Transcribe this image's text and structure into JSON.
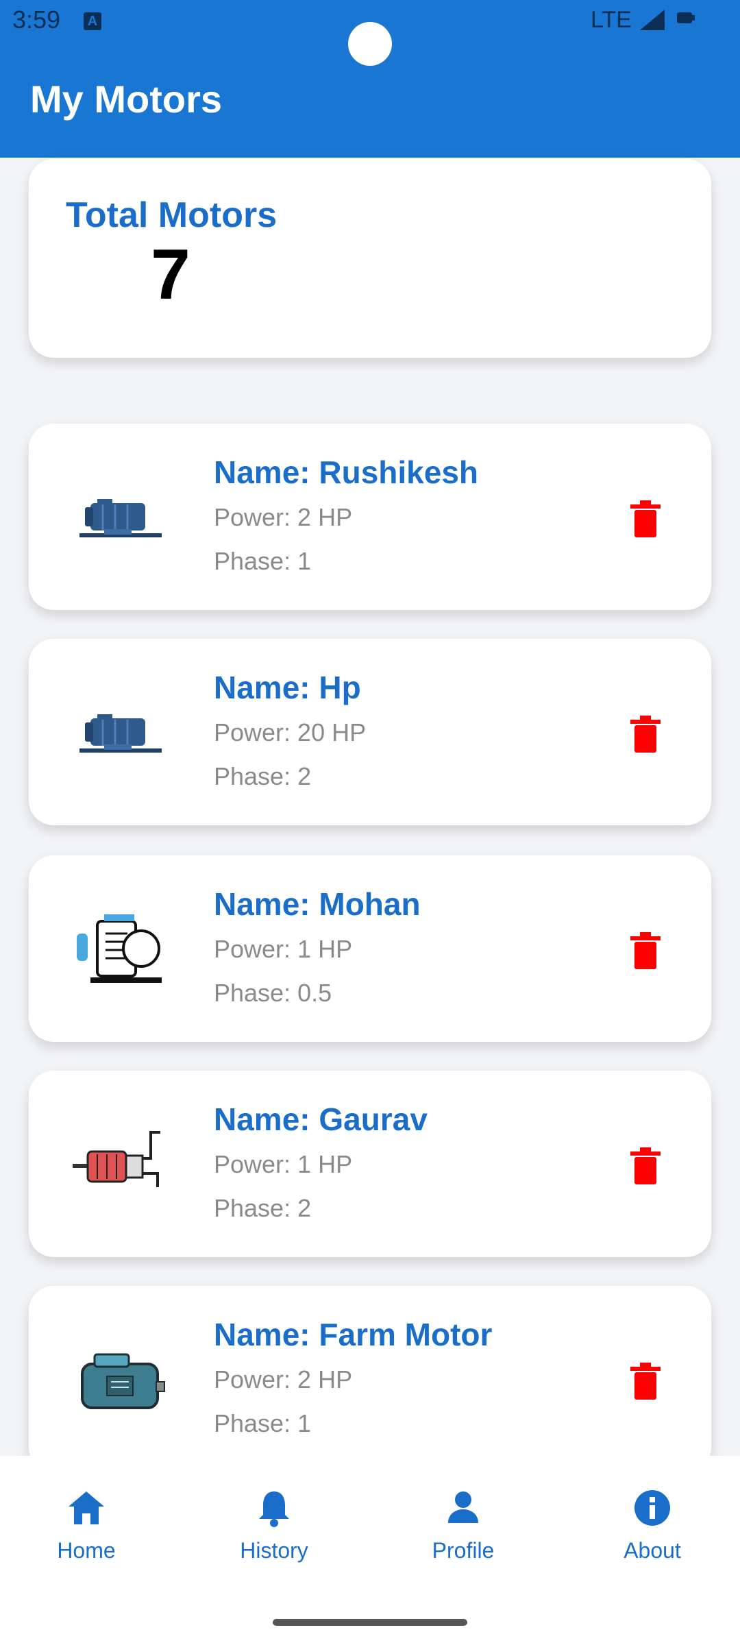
{
  "status": {
    "time": "3:59",
    "network": "LTE"
  },
  "app": {
    "title": "My Motors"
  },
  "summary": {
    "label": "Total Motors",
    "value": "7"
  },
  "motors": [
    {
      "name": "Name: Rushikesh",
      "power": "Power: 2 HP",
      "phase": "Phase: 1",
      "icon": "pump-motor-icon"
    },
    {
      "name": "Name: Hp",
      "power": "Power: 20 HP",
      "phase": "Phase: 2",
      "icon": "pump-motor-icon"
    },
    {
      "name": "Name: Mohan",
      "power": "Power: 1 HP",
      "phase": "Phase: 0.5",
      "icon": "electric-motor-line-icon"
    },
    {
      "name": "Name: Gaurav",
      "power": "Power: 1 HP",
      "phase": "Phase: 2",
      "icon": "red-pump-icon"
    },
    {
      "name": "Name: Farm Motor",
      "power": "Power: 2 HP",
      "phase": "Phase: 1",
      "icon": "teal-motor-icon"
    }
  ],
  "nav": [
    {
      "label": "Home",
      "icon": "home-icon"
    },
    {
      "label": "History",
      "icon": "bell-icon"
    },
    {
      "label": "Profile",
      "icon": "person-icon"
    },
    {
      "label": "About",
      "icon": "info-icon"
    }
  ],
  "colors": {
    "primary": "#1976d2",
    "accent_text": "#1a6ec9",
    "delete": "#ff0000"
  }
}
